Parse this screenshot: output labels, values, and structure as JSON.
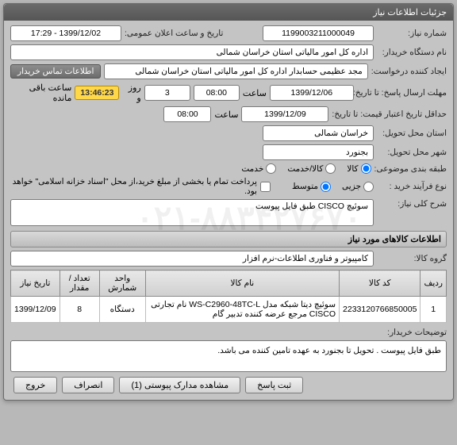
{
  "window_title": "جزئیات اطلاعات نیاز",
  "labels": {
    "need_no": "شماره نیاز:",
    "announce": "تاریخ و ساعت اعلان عمومی:",
    "buyer_org": "نام دستگاه خریدار:",
    "creator": "ایجاد کننده درخواست:",
    "contact_btn": "اطلاعات تماس خریدار",
    "send_deadline": "مهلت ارسال پاسخ: تا تاریخ:",
    "hour": "ساعت",
    "and": "و",
    "day": "روز و",
    "remaining": "ساعت باقی مانده",
    "price_deadline": "حداقل تاریخ اعتبار قیمت: تا تاریخ:",
    "delivery_province": "استان محل تحویل:",
    "delivery_city": "شهر محل تحویل:",
    "category": "طبقه بندی موضوعی:",
    "goods": "کالا",
    "serv_goods": "کالا/خدمت",
    "service": "خدمت",
    "process_type": "نوع فرآیند خرید :",
    "p_small": "جزیی",
    "p_mid": "متوسط",
    "partial_pay": "پرداخت تمام یا بخشی از مبلغ خرید،از محل \"اسناد خزانه اسلامی\" خواهد بود.",
    "desc": "شرح کلی نیاز:",
    "items_head": "اطلاعات کالاهای مورد نیاز",
    "item_group": "گروه کالا:",
    "col_row": "ردیف",
    "col_code": "کد کالا",
    "col_name": "نام کالا",
    "col_unit": "واحد شمارش",
    "col_qty": "تعداد / مقدار",
    "col_date": "تاریخ نیاز",
    "buyer_notes": "توضیحات خریدار:"
  },
  "fields": {
    "need_no": "1199003211000049",
    "announce": "1399/12/02 - 17:29",
    "buyer_org": "اداره کل امور مالیاتی استان خراسان شمالی",
    "creator": "مجد عظیمی حسابدار اداره کل امور مالیاتی استان خراسان شمالی",
    "send_date": "1399/12/06",
    "send_time": "08:00",
    "days_left": "3",
    "timer": "13:46:23",
    "price_date": "1399/12/09",
    "price_time": "08:00",
    "province": "خراسان شمالی",
    "city": "بجنورد",
    "desc": "سوئیچ CISCO طبق فایل پیوست",
    "item_group": "کامپیوتر و فناوری اطلاعات-نرم افزار",
    "buyer_notes": "طبق فایل پیوست . تحویل تا بجنورد به عهده تامین کننده می باشد."
  },
  "table_row": {
    "idx": "1",
    "code": "2233120766850005",
    "name": "سوئیچ دیتا شبکه مدل WS-C2960-48TC-L نام تجارتی CISCO مرجع عرضه کننده تدبیر گام",
    "unit": "دستگاه",
    "qty": "8",
    "date": "1399/12/09"
  },
  "buttons": {
    "reply": "ثبت پاسخ",
    "attachments": "مشاهده مدارک پیوستی (1)",
    "reject": "انصراف",
    "exit": "خروج"
  },
  "watermark": "۰۲۱-۸۸۳۴۲۷۶۷۰"
}
